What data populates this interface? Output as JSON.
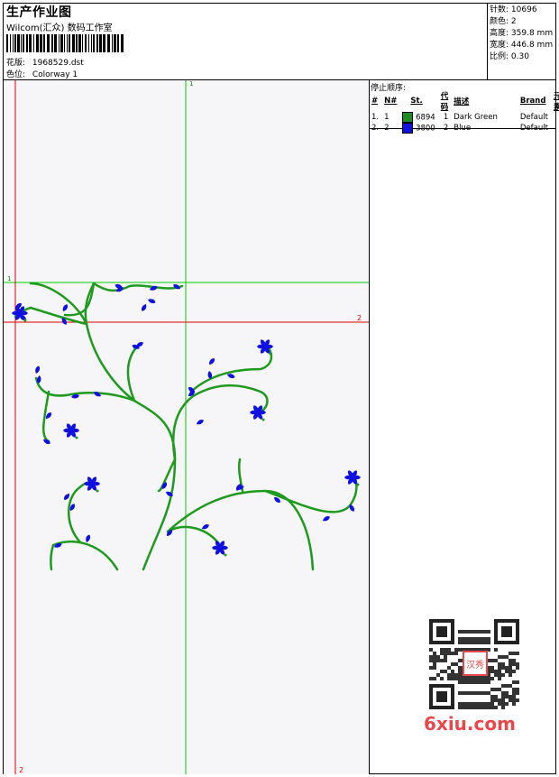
{
  "header": {
    "title": "生产作业图",
    "studio": "Wilcom(汇众) 数码工作室",
    "design_label": "花版:",
    "design_value": "1968529.dst",
    "colorway_label": "色位:",
    "colorway_value": "Colorway 1"
  },
  "stats": [
    {
      "label": "针数:",
      "value": "10696"
    },
    {
      "label": "颜色:",
      "value": "2"
    },
    {
      "label": "高度:",
      "value": "359.8 mm"
    },
    {
      "label": "宽度:",
      "value": "446.8 mm"
    },
    {
      "label": "比例:",
      "value": "0.30"
    }
  ],
  "stop_sequence": {
    "title": "停止顺序:",
    "columns": [
      "#",
      "N#",
      "St.",
      "代码",
      "描述",
      "Brand",
      "元素"
    ],
    "rows": [
      {
        "index": "1.",
        "needle": "1",
        "swatch": "#1e8c1e",
        "stitches": "6894",
        "code": "1",
        "desc": "Dark Green",
        "brand": "Default"
      },
      {
        "index": "2.",
        "needle": "2",
        "swatch": "#1010e0",
        "stitches": "3800",
        "code": "2",
        "desc": "Blue",
        "brand": "Default"
      }
    ]
  },
  "guides": {
    "green_h": "1",
    "green_v": "1",
    "red_h": "2",
    "red_v": "2"
  },
  "colors": {
    "thread_green": "#1e9a1e",
    "thread_blue": "#1010e0",
    "guide_green": "#00d000",
    "guide_red": "#e00000"
  },
  "watermark": {
    "text": "6xiu.com",
    "stamp": "汉秀"
  }
}
